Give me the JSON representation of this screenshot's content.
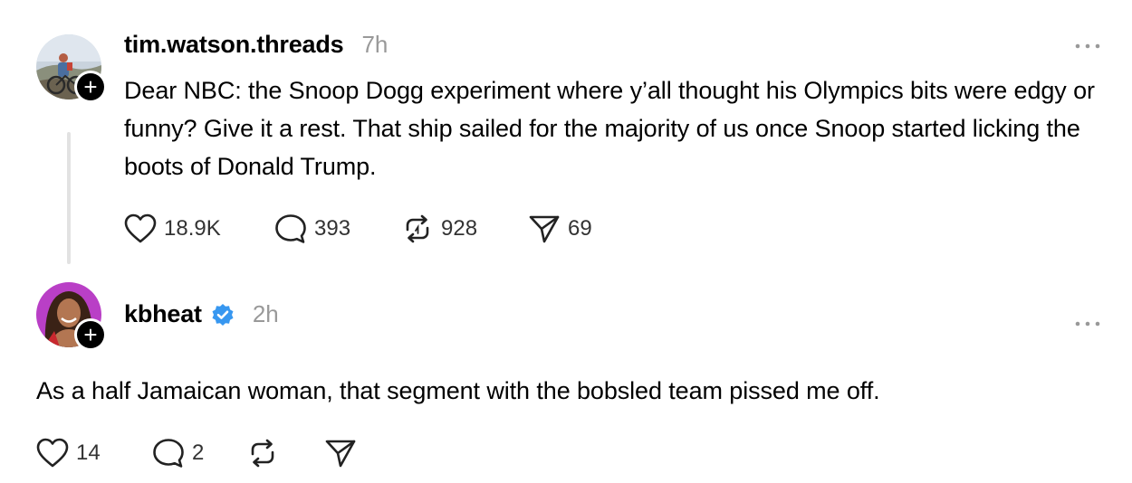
{
  "posts": [
    {
      "username": "tim.watson.threads",
      "time": "7h",
      "text": "Dear NBC: the Snoop Dogg experiment where y’all thought his Olympics bits were edgy or funny? Give it a rest. That ship sailed for the majority of us once Snoop started licking the boots of Donald Trump.",
      "likes": "18.9K",
      "replies": "393",
      "reposts": "928",
      "shares": "69",
      "verified": false
    },
    {
      "username": "kbheat",
      "time": "2h",
      "text": "As a half Jamaican woman, that segment with the bobsled team pissed me off.",
      "likes": "14",
      "replies": "2",
      "reposts": "",
      "shares": "",
      "verified": true
    }
  ],
  "icons": {
    "more": "more-horizontal-icon",
    "like": "heart-icon",
    "reply": "speech-bubble-icon",
    "repost": "repost-arrows-icon",
    "share": "paper-plane-icon",
    "verified": "verified-badge-icon",
    "follow": "plus-icon"
  },
  "colors": {
    "verified_blue": "#3797f0",
    "muted_gray": "#999999",
    "thread_line": "#e2e2e2"
  }
}
